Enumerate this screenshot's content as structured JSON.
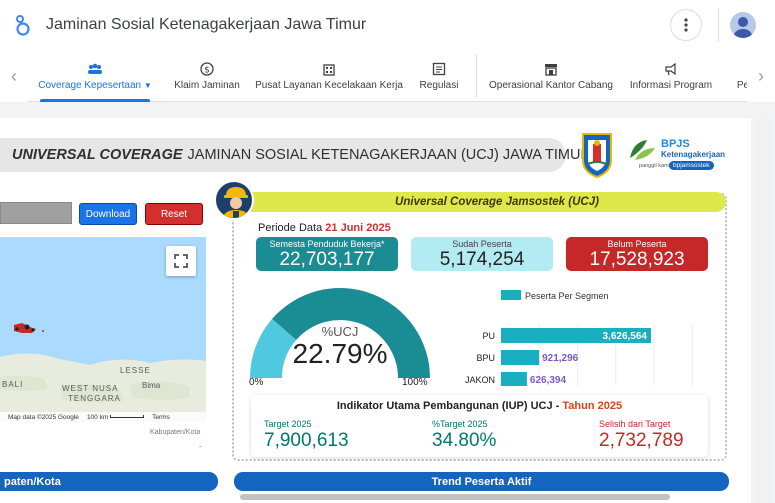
{
  "app": {
    "title": "Jaminan Sosial Ketenagakerjaan Jawa Timur"
  },
  "tabs": [
    {
      "label": "Coverage Kepesertaan",
      "icon": "people-icon",
      "active": true
    },
    {
      "label": "Klaim Jaminan",
      "icon": "dollar-circle-icon"
    },
    {
      "label": "Pusat Layanan Kecelakaan Kerja",
      "icon": "building-icon"
    },
    {
      "label": "Regulasi",
      "icon": "document-icon"
    },
    {
      "label": "Operasional Kantor Cabang",
      "icon": "store-icon"
    },
    {
      "label": "Informasi Program",
      "icon": "megaphone-icon"
    },
    {
      "label": "Pe"
    }
  ],
  "report": {
    "title_italic": "UNIVERSAL COVERAGE",
    "title_rest": "JAMINAN SOSIAL KETENAGAKERJAAN (UCJ) JAWA TIMUR",
    "bpjs": {
      "brand": "BPJS",
      "sub": "Ketenagakerjaan",
      "tagline": "panggil kami",
      "tag": "bpjamsostek"
    },
    "buttons": {
      "download": "Download",
      "reset": "Reset"
    },
    "map": {
      "labels": {
        "bali": "BALI",
        "west_nusa": "WEST NUSA",
        "tenggara": "TENGGARA",
        "lesser": "LESSE",
        "bima": "Bima"
      },
      "footer": {
        "data": "Map data ©2025 Google",
        "scale": "100 km",
        "terms": "Terms"
      },
      "fullscreen_icon": "fullscreen-icon",
      "zoom_in": "+",
      "zoom_out": "−",
      "kabupaten_label": "Kabupaten/Kota",
      "kabupaten_value": "-"
    },
    "ucj": {
      "header": "Universal Coverage Jamsostek (UCJ)",
      "periode_label": "Periode Data",
      "periode_date": "21 Juni 2025",
      "kpis": [
        {
          "label": "Semesta Penduduk Bekerja*",
          "value": "22,703,177",
          "bg": "#1a8c93",
          "fg": "#ffffff"
        },
        {
          "label": "Sudah Peserta",
          "value": "5,174,254",
          "bg": "#b2ebf2",
          "fg": "#222222"
        },
        {
          "label": "Belum Peserta",
          "value": "17,528,923",
          "bg": "#c62828",
          "fg": "#ffffff"
        }
      ],
      "gauge": {
        "label": "%UCJ",
        "value_text": "22.79%",
        "value": 22.79,
        "min_label": "0%",
        "max_label": "100%"
      },
      "segments": {
        "legend": "Peserta Per Segmen",
        "color": "#19aec0",
        "items": [
          {
            "name": "PU",
            "value": 3626564,
            "label": "3,626,564"
          },
          {
            "name": "BPU",
            "value": 921296,
            "label": "921,296"
          },
          {
            "name": "JAKON",
            "value": 626394,
            "label": "626,394"
          }
        ]
      },
      "iup": {
        "title": "Indikator Utama Pembangunan (IUP) UCJ -",
        "year": "Tahun 2025",
        "cols": [
          {
            "label": "Target 2025",
            "value": "7,900,613",
            "color": "#00796b"
          },
          {
            "label": "%Target 2025",
            "value": "34.80%",
            "color": "#00796b"
          },
          {
            "label": "Selisih dari Target",
            "value": "2,732,789",
            "color": "#c62828"
          }
        ]
      }
    },
    "bottom": {
      "left": "paten/Kota",
      "right": "Trend Peserta Aktif"
    }
  }
}
